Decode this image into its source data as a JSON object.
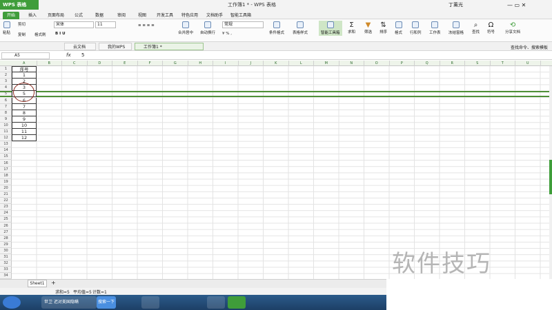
{
  "app": {
    "logo": "WPS 表格",
    "title": "工作簿1 * - WPS 表格",
    "user": "丁薰光"
  },
  "menu_tabs": [
    "开始",
    "插入",
    "页面布局",
    "公式",
    "数据",
    "审阅",
    "视图",
    "开发工具",
    "特色应用",
    "文档助手",
    "智能工具箱"
  ],
  "ribbon": {
    "paste": "粘贴",
    "cut": "剪切",
    "copy": "复制",
    "format_painter": "格式刷",
    "font": "宋体",
    "size": "11",
    "number_format": "常规",
    "merge": "合并居中",
    "wrap": "自动换行",
    "cond_format": "条件格式",
    "table_style": "表格样式",
    "smart_tools": "智能工具箱",
    "sum": "求和",
    "filter": "筛选",
    "sort": "排序",
    "format": "格式",
    "rowcol": "行和列",
    "sheet": "工作表",
    "freeze": "冻结窗格",
    "find": "查找",
    "symbol": "符号",
    "share": "分享文档"
  },
  "doc_tabs": [
    "云文档",
    "我的WPS",
    "工作簿1 *"
  ],
  "search_hint": "查找命令、搜索模板",
  "formula": {
    "cell_ref": "A5",
    "fx": "fx",
    "value": "5"
  },
  "columns": [
    "A",
    "B",
    "C",
    "D",
    "E",
    "F",
    "G",
    "H",
    "I",
    "J",
    "K",
    "L",
    "M",
    "N",
    "O",
    "P",
    "Q",
    "R",
    "S",
    "T",
    "U"
  ],
  "rows": [
    "1",
    "2",
    "3",
    "4",
    "5",
    "6",
    "7",
    "8",
    "9",
    "10",
    "11",
    "12",
    "13",
    "14",
    "15",
    "16",
    "17",
    "18",
    "19",
    "20",
    "21",
    "22",
    "23",
    "24",
    "25",
    "26",
    "27",
    "28",
    "29",
    "30",
    "31",
    "32",
    "33",
    "34"
  ],
  "cells": [
    "序号",
    "1",
    "2",
    "3",
    "5",
    "6",
    "7",
    "8",
    "9",
    "10",
    "11",
    "12"
  ],
  "sheet_tab": "Sheet1",
  "status": {
    "sum": "求和=5",
    "avg": "平均值=5",
    "count": "计数=1"
  },
  "taskbar": {
    "ie_title": "世卫 迟对美国隐瞒",
    "search_btn": "搜索一下"
  },
  "watermark": "软件技巧"
}
